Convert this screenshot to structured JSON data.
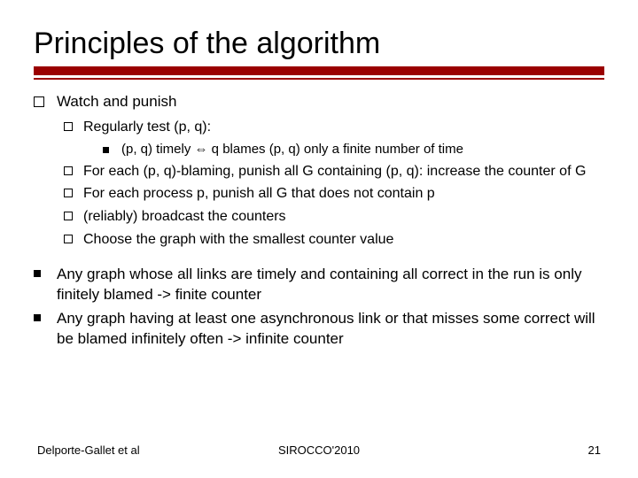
{
  "title": "Principles of the algorithm",
  "b1": {
    "head": "Watch and punish",
    "i1": "Regularly test (p, q):",
    "i1a": "(p, q) timely ⇔ q blames (p, q) only a finite number of time",
    "i2": "For each (p, q)-blaming, punish all G containing (p, q): increase the counter of G",
    "i3": "For each process p, punish all G that does not contain p",
    "i4": "(reliably) broadcast the counters",
    "i5": "Choose the graph with the smallest counter value"
  },
  "b2": {
    "j1": "Any graph whose all links are timely and containing all correct in the run is only finitely blamed -> finite counter",
    "j2": "Any graph having at least one asynchronous link or that misses some correct will be blamed infinitely often -> infinite counter"
  },
  "footer": {
    "left": "Delporte-Gallet et al",
    "center": "SIROCCO'2010",
    "right": "21"
  }
}
